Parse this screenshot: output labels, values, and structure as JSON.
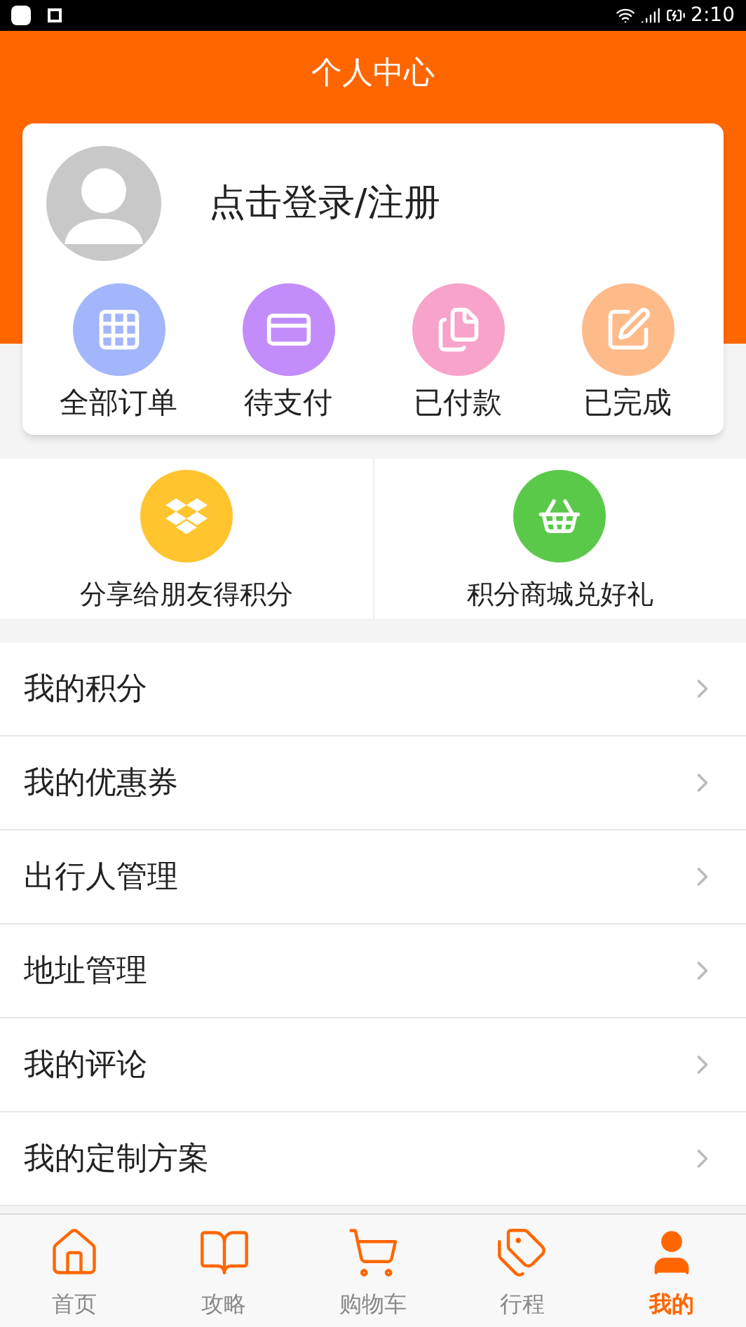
{
  "status_bar": {
    "time": "2:10"
  },
  "header": {
    "title": "个人中心"
  },
  "profile": {
    "login_text": "点击登录/注册"
  },
  "order_shortcuts": [
    {
      "label": "全部订单",
      "kind": "all",
      "color": "#a3b5fb"
    },
    {
      "label": "待支付",
      "kind": "pay",
      "color": "#c38cfb"
    },
    {
      "label": "已付款",
      "kind": "paid",
      "color": "#f8a3c9"
    },
    {
      "label": "已完成",
      "kind": "done",
      "color": "#fdbb8a"
    }
  ],
  "promos": [
    {
      "label": "分享给朋友得积分",
      "kind": "share",
      "color": "#ffc42e"
    },
    {
      "label": "积分商城兑好礼",
      "kind": "mall",
      "color": "#5ac94a"
    }
  ],
  "menu": [
    {
      "label": "我的积分"
    },
    {
      "label": "我的优惠券"
    },
    {
      "label": "出行人管理"
    },
    {
      "label": "地址管理"
    },
    {
      "label": "我的评论"
    },
    {
      "label": "我的定制方案"
    }
  ],
  "tab_bar": [
    {
      "label": "首页",
      "kind": "home",
      "selected": false
    },
    {
      "label": "攻略",
      "kind": "guide",
      "selected": false
    },
    {
      "label": "购物车",
      "kind": "cart",
      "selected": false
    },
    {
      "label": "行程",
      "kind": "trip",
      "selected": false
    },
    {
      "label": "我的",
      "kind": "me",
      "selected": true
    }
  ]
}
